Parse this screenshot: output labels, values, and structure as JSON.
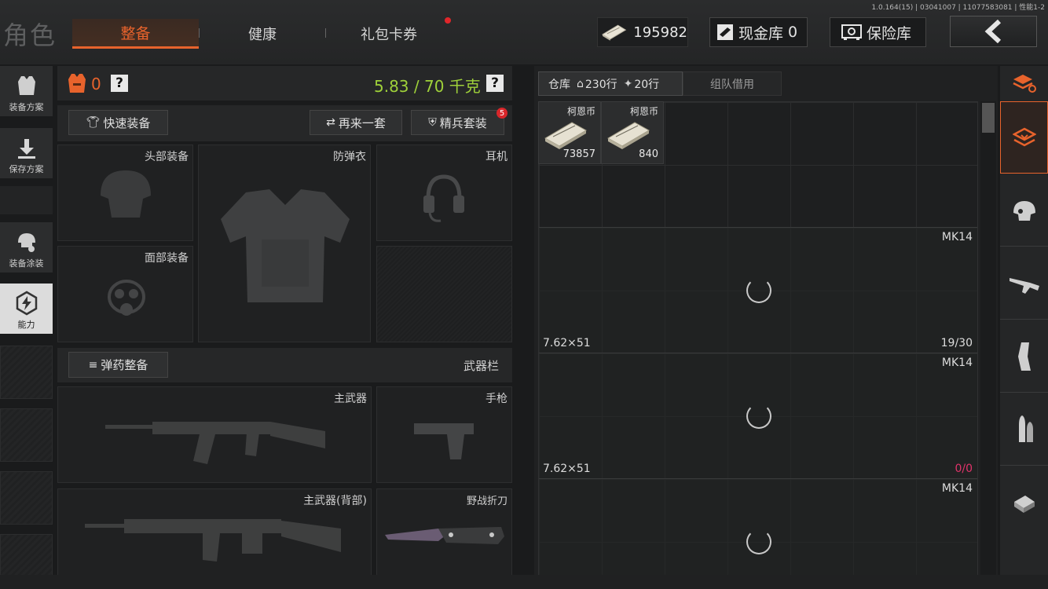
{
  "header": {
    "title": "角色",
    "tabs": [
      {
        "label": "整备",
        "active": true
      },
      {
        "label": "健康",
        "active": false
      },
      {
        "label": "礼包卡券",
        "active": false,
        "badge": "red-dot"
      }
    ],
    "version": "1.0.164(15) | 03041007 | 11077583081 | 性能1-2",
    "money": "195982",
    "cash_vault_label": "现金库",
    "cash_vault_count": "0",
    "safe_label": "保险库",
    "back_icon": "chevron-left-icon"
  },
  "sidebar": {
    "items": [
      {
        "label": "装备方案",
        "icon": "vest-icon"
      },
      {
        "label": "保存方案",
        "icon": "download-icon"
      },
      {
        "label": "装备涂装",
        "icon": "helmet-skin-icon"
      },
      {
        "label": "能力",
        "icon": "ability-icon",
        "active": true
      }
    ]
  },
  "equipment": {
    "armor_count": "0",
    "help_mark": "?",
    "weight_text": "5.83 / 70 千克",
    "weight_color": "#9fd13a",
    "quick_equip": "快速装备",
    "again_set": "再来一套",
    "elite_set": "精兵套装",
    "elite_badge": "5",
    "slots": {
      "head": "头部装备",
      "armor": "防弹衣",
      "headset": "耳机",
      "face": "面部装备"
    },
    "ammo_setup": "弹药整备",
    "weapon_bar": "武器栏",
    "weapon_slots": {
      "primary": "主武器",
      "pistol": "手枪",
      "primary_back": "主武器(背部)",
      "knife": "野战折刀"
    }
  },
  "warehouse": {
    "tab_label": "仓库",
    "rows_home": "230行",
    "rows_ammo": "20行",
    "team_borrow": "组队借用",
    "cash_items": [
      {
        "name": "柯恩币",
        "amount": "73857"
      },
      {
        "name": "柯恩币",
        "amount": "840"
      }
    ],
    "weapons": [
      {
        "name": "MK14",
        "ammo": "7.62×51",
        "count": "19/30",
        "count_color": "#dddddd"
      },
      {
        "name": "MK14",
        "ammo": "7.62×51",
        "count_current": "0",
        "count_total": "/0",
        "count_color": "#e0336a"
      },
      {
        "name": "MK14",
        "ammo": "",
        "count": ""
      }
    ]
  },
  "categories": [
    "stack-download-icon",
    "helmet-icon",
    "rifle-icon",
    "magazine-icon",
    "bullet-icon",
    "scope-icon"
  ],
  "accent_color": "#e8632c"
}
